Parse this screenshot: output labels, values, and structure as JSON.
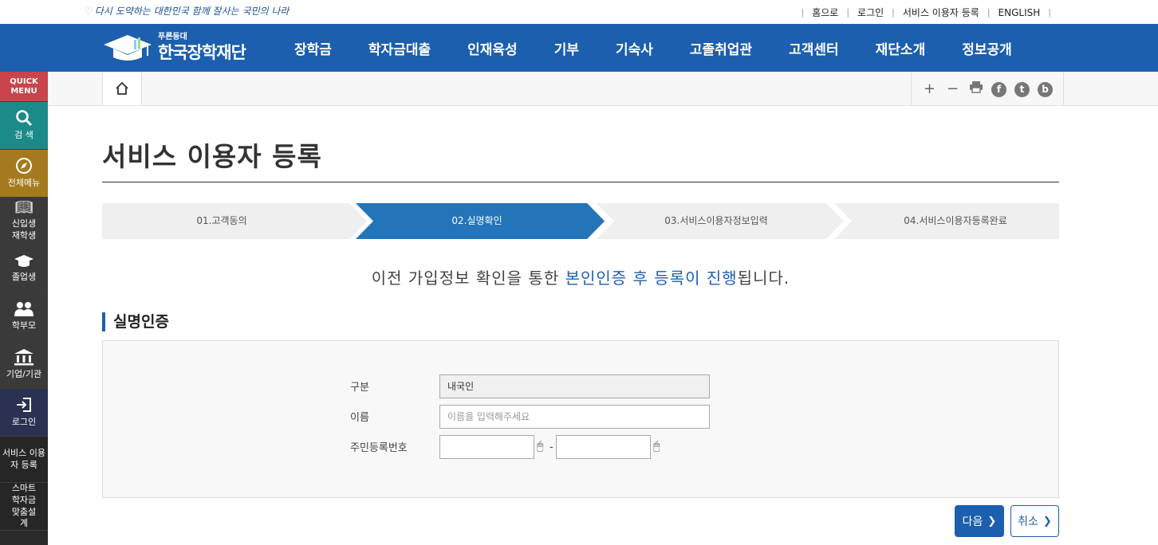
{
  "slogan": "다시 도약하는 대한민국 함께 잘사는 국민의 나라",
  "util_links": [
    "홈으로",
    "로그인",
    "서비스 이용자 등록",
    "ENGLISH"
  ],
  "logo": {
    "sub": "푸른등대",
    "main": "한국장학재단"
  },
  "nav": [
    "장학금",
    "학자금대출",
    "인재육성",
    "기부",
    "기숙사",
    "고졸취업관",
    "고객센터",
    "재단소개",
    "정보공개"
  ],
  "quick_menu": {
    "title": "QUICK MENU",
    "items": [
      {
        "label": "검 색",
        "icon": "search-icon"
      },
      {
        "label": "전체메뉴",
        "icon": "compass-icon"
      },
      {
        "label": "신입생 재학생",
        "icon": "book-icon"
      },
      {
        "label": "졸업생",
        "icon": "graduation-cap-icon"
      },
      {
        "label": "학부모",
        "icon": "parents-icon"
      },
      {
        "label": "기업/기관",
        "icon": "institution-icon"
      },
      {
        "label": "로그인",
        "icon": "login-icon"
      },
      {
        "label": "서비스 이용자 등록"
      },
      {
        "label": "스마트 학자금 맞춤설계"
      }
    ]
  },
  "tools": [
    "zoom-in-icon",
    "zoom-out-icon",
    "print-icon",
    "facebook-icon",
    "twitter-icon",
    "blog-icon"
  ],
  "page_title": "서비스 이용자 등록",
  "steps": [
    {
      "label": "01.고객동의",
      "active": false
    },
    {
      "label": "02.실명확인",
      "active": true
    },
    {
      "label": "03.서비스이용자정보입력",
      "active": false
    },
    {
      "label": "04.서비스이용자등록완료",
      "active": false
    }
  ],
  "intro": {
    "before": "이전 가입정보 확인을 통한 ",
    "highlight": "본인인증 후 등록이 진행",
    "after": "됩니다."
  },
  "section_title": "실명인증",
  "form": {
    "type_label": "구분",
    "type_value": "내국인",
    "name_label": "이름",
    "name_placeholder": "이름을 입력해주세요",
    "rrn_label": "주민등록번호",
    "rrn_separator": "-"
  },
  "buttons": {
    "next": "다음",
    "cancel": "취소"
  },
  "colors": {
    "primary": "#1c5fae",
    "step_inactive": "#efefef",
    "quick_title": "#c9444b"
  }
}
